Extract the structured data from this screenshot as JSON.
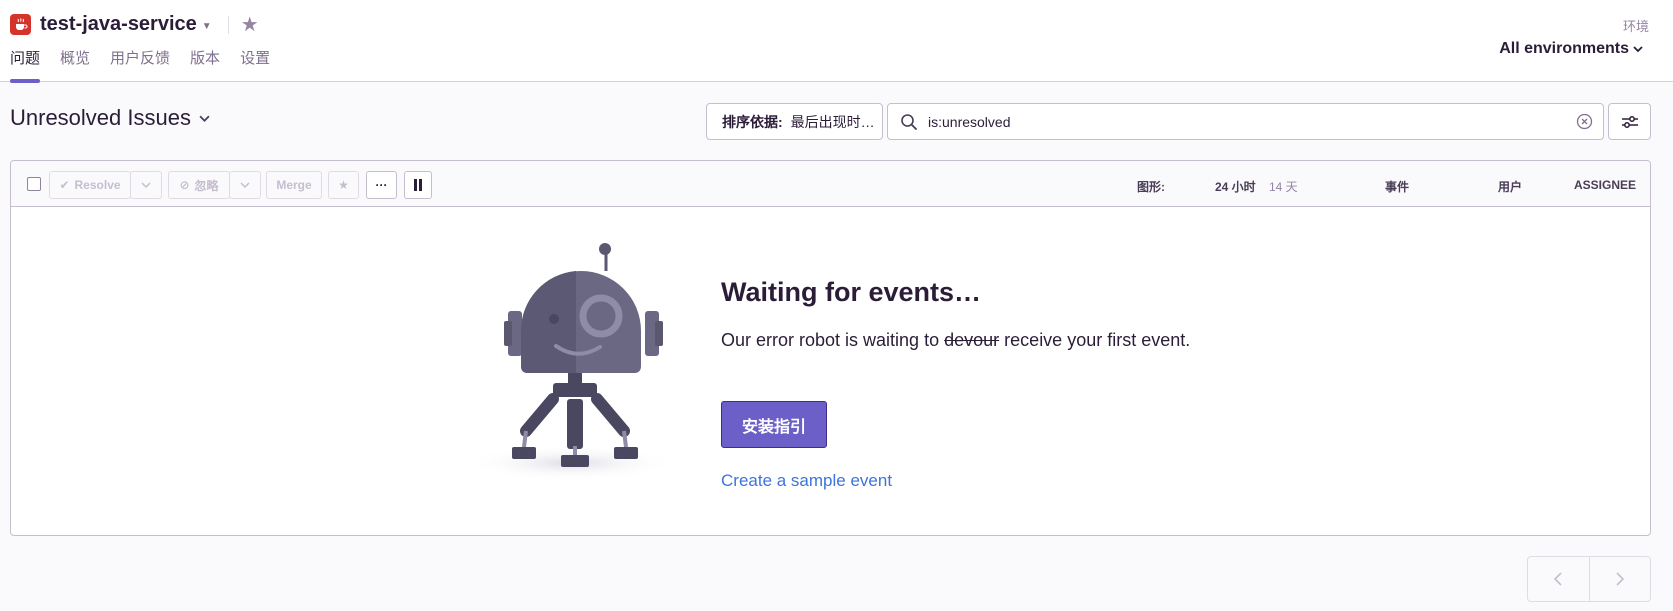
{
  "header": {
    "project_name": "test-java-service",
    "tabs": [
      {
        "label": "问题",
        "active": true
      },
      {
        "label": "概览",
        "active": false
      },
      {
        "label": "用户反馈",
        "active": false
      },
      {
        "label": "版本",
        "active": false
      },
      {
        "label": "设置",
        "active": false
      }
    ],
    "env_label": "环境",
    "env_value": "All environments"
  },
  "main": {
    "title": "Unresolved Issues",
    "sort_prefix": "排序依据:",
    "sort_value": "最后出现时…",
    "search_value": "is:unresolved"
  },
  "toolbar": {
    "resolve_label": "Resolve",
    "ignore_label": "忽略",
    "merge_label": "Merge",
    "more_label": "···",
    "graph_label": "图形:",
    "graph_24h": "24 小时",
    "graph_14d": "14 天",
    "events_col": "事件",
    "users_col": "用户",
    "assignee_col": "ASSIGNEE"
  },
  "empty_state": {
    "title": "Waiting for events…",
    "message_before": "Our error robot is waiting to",
    "message_strike": "devour",
    "message_after": "receive your first event.",
    "install_label": "安装指引",
    "sample_link": "Create a sample event"
  },
  "colors": {
    "accent": "#6c5fc7",
    "link": "#3d74db",
    "project_logo": "#d4342a"
  },
  "icons": {
    "project": "java-coffee-icon",
    "star": "star-icon",
    "search": "search-icon",
    "clear": "clear-circle-icon",
    "filter": "sliders-icon",
    "pause": "pause-icon"
  }
}
